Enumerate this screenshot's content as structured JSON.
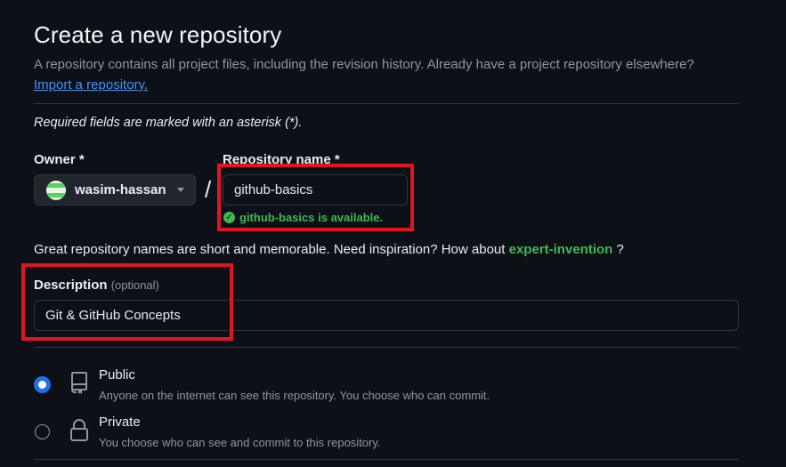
{
  "header": {
    "title": "Create a new repository",
    "subtitle": "A repository contains all project files, including the revision history. Already have a project repository elsewhere?",
    "import_link": "Import a repository."
  },
  "form": {
    "required_note": "Required fields are marked with an asterisk (*).",
    "owner": {
      "label": "Owner *",
      "value": "wasim-hassan"
    },
    "separator": "/",
    "repo_name": {
      "label": "Repository name *",
      "value": "github-basics",
      "availability": "github-basics is available."
    },
    "name_hint": {
      "prefix": "Great repository names are short and memorable. Need inspiration? How about",
      "suggestion": "expert-invention",
      "suffix": "?"
    },
    "description": {
      "label": "Description",
      "optional": "(optional)",
      "value": "Git & GitHub Concepts"
    },
    "visibility": [
      {
        "title": "Public",
        "desc": "Anyone on the internet can see this repository. You choose who can commit.",
        "selected": true,
        "icon": "repo-icon"
      },
      {
        "title": "Private",
        "desc": "You choose who can see and commit to this repository.",
        "selected": false,
        "icon": "lock-icon"
      }
    ]
  },
  "colors": {
    "background": "#0d1117",
    "link": "#4493f8",
    "success": "#3fb950",
    "highlight": "#e0161f",
    "radio": "#1f6feb"
  }
}
